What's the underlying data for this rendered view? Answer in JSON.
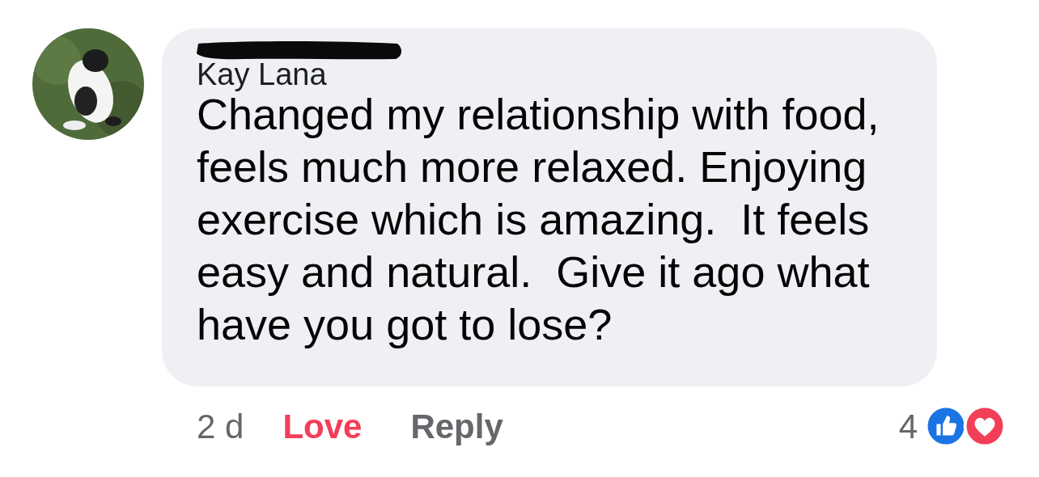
{
  "comment": {
    "author": "Kay Lana",
    "redacted": true,
    "text": "Changed my relationship with food, feels much more relaxed. Enjoying exercise which is amazing.  It feels easy and natural.  Give it ago what have you got to lose?"
  },
  "footer": {
    "time": "2 d",
    "reaction_button": {
      "label": "Love",
      "selected": true
    },
    "reply": "Reply",
    "reaction_count": "4"
  }
}
